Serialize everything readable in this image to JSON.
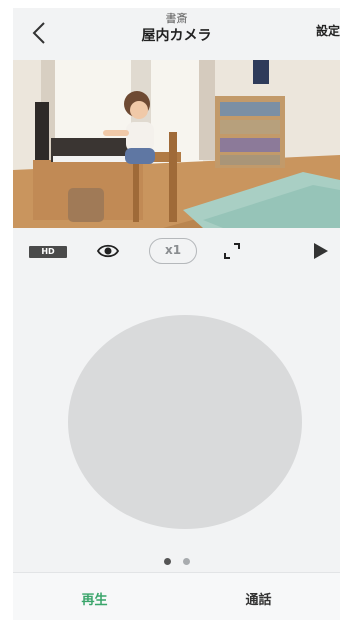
{
  "header": {
    "subtitle": "書斎",
    "title": "屋内カメラ",
    "settings_label": "設定",
    "back_icon": "chevron-left-icon"
  },
  "camera": {
    "description_icon": "live-camera-feed"
  },
  "toolbar": {
    "hd_label": "HD",
    "zoom_label": "x1",
    "eye_icon": "eye-icon",
    "fullscreen_icon": "fullscreen-icon",
    "play_icon": "play-icon"
  },
  "pager": {
    "pages": 2,
    "active_index": 0
  },
  "tabs": {
    "play_label": "再生",
    "call_label": "通話",
    "active_color": "#3aa56b"
  }
}
